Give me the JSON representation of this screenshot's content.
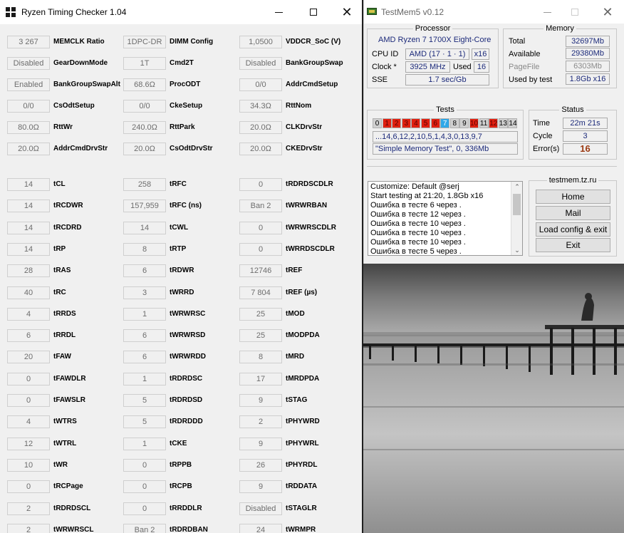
{
  "rtc": {
    "title": "Ryzen Timing Checker 1.04",
    "rows": [
      [
        {
          "v": "3 267",
          "l": "MEMCLK Ratio"
        },
        {
          "v": "1DPC-DR",
          "l": "DIMM Config"
        },
        {
          "v": "1,0500",
          "l": "VDDCR_SoC (V)"
        }
      ],
      [
        {
          "v": "Disabled",
          "l": "GearDownMode"
        },
        {
          "v": "1T",
          "l": "Cmd2T"
        },
        {
          "v": "Disabled",
          "l": "BankGroupSwap"
        }
      ],
      [
        {
          "v": "Enabled",
          "l": "BankGroupSwapAlt"
        },
        {
          "v": "68.6Ω",
          "l": "ProcODT"
        },
        {
          "v": "0/0",
          "l": "AddrCmdSetup"
        }
      ],
      [
        {
          "v": "0/0",
          "l": "CsOdtSetup"
        },
        {
          "v": "0/0",
          "l": "CkeSetup"
        },
        {
          "v": "34.3Ω",
          "l": "RttNom"
        }
      ],
      [
        {
          "v": "80.0Ω",
          "l": "RttWr"
        },
        {
          "v": "240.0Ω",
          "l": "RttPark"
        },
        {
          "v": "20.0Ω",
          "l": "CLKDrvStr"
        }
      ],
      [
        {
          "v": "20.0Ω",
          "l": "AddrCmdDrvStr"
        },
        {
          "v": "20.0Ω",
          "l": "CsOdtDrvStr"
        },
        {
          "v": "20.0Ω",
          "l": "CKEDrvStr"
        }
      ],
      [
        {
          "v": "14",
          "l": "tCL"
        },
        {
          "v": "258",
          "l": "tRFC"
        },
        {
          "v": "0",
          "l": "tRDRDSCDLR"
        }
      ],
      [
        {
          "v": "14",
          "l": "tRCDWR"
        },
        {
          "v": "157,959",
          "l": "tRFC (ns)"
        },
        {
          "v": "Ban 2",
          "l": "tWRWRBAN"
        }
      ],
      [
        {
          "v": "14",
          "l": "tRCDRD"
        },
        {
          "v": "14",
          "l": "tCWL"
        },
        {
          "v": "0",
          "l": "tWRWRSCDLR"
        }
      ],
      [
        {
          "v": "14",
          "l": "tRP"
        },
        {
          "v": "8",
          "l": "tRTP"
        },
        {
          "v": "0",
          "l": "tWRRDSCDLR"
        }
      ],
      [
        {
          "v": "28",
          "l": "tRAS"
        },
        {
          "v": "6",
          "l": "tRDWR"
        },
        {
          "v": "12746",
          "l": "tREF"
        }
      ],
      [
        {
          "v": "40",
          "l": "tRC"
        },
        {
          "v": "3",
          "l": "tWRRD"
        },
        {
          "v": "7 804",
          "l": "tREF (µs)"
        }
      ],
      [
        {
          "v": "4",
          "l": "tRRDS"
        },
        {
          "v": "1",
          "l": "tWRWRSC"
        },
        {
          "v": "25",
          "l": "tMOD"
        }
      ],
      [
        {
          "v": "6",
          "l": "tRRDL"
        },
        {
          "v": "6",
          "l": "tWRWRSD"
        },
        {
          "v": "25",
          "l": "tMODPDA"
        }
      ],
      [
        {
          "v": "20",
          "l": "tFAW"
        },
        {
          "v": "6",
          "l": "tWRWRDD"
        },
        {
          "v": "8",
          "l": "tMRD"
        }
      ],
      [
        {
          "v": "0",
          "l": "tFAWDLR"
        },
        {
          "v": "1",
          "l": "tRDRDSC"
        },
        {
          "v": "17",
          "l": "tMRDPDA"
        }
      ],
      [
        {
          "v": "0",
          "l": "tFAWSLR"
        },
        {
          "v": "5",
          "l": "tRDRDSD"
        },
        {
          "v": "9",
          "l": "tSTAG"
        }
      ],
      [
        {
          "v": "4",
          "l": "tWTRS"
        },
        {
          "v": "5",
          "l": "tRDRDDD"
        },
        {
          "v": "2",
          "l": "tPHYWRD"
        }
      ],
      [
        {
          "v": "12",
          "l": "tWTRL"
        },
        {
          "v": "1",
          "l": "tCKE"
        },
        {
          "v": "9",
          "l": "tPHYWRL"
        }
      ],
      [
        {
          "v": "10",
          "l": "tWR"
        },
        {
          "v": "0",
          "l": "tRPPB"
        },
        {
          "v": "26",
          "l": "tPHYRDL"
        }
      ],
      [
        {
          "v": "0",
          "l": "tRCPage"
        },
        {
          "v": "0",
          "l": "tRCPB"
        },
        {
          "v": "9",
          "l": "tRDDATA"
        }
      ],
      [
        {
          "v": "2",
          "l": "tRDRDSCL"
        },
        {
          "v": "0",
          "l": "tRRDDLR"
        },
        {
          "v": "Disabled",
          "l": "tSTAGLR"
        }
      ],
      [
        {
          "v": "2",
          "l": "tWRWRSCL"
        },
        {
          "v": "Ban 2",
          "l": "tRDRDBAN"
        },
        {
          "v": "24",
          "l": "tWRMPR"
        }
      ]
    ]
  },
  "tm": {
    "title": "TestMem5 v0.12",
    "processor": {
      "title": "Processor",
      "name": "AMD Ryzen 7 1700X Eight-Core",
      "cpu_id_label": "CPU ID",
      "cpu_id": "AMD  (17 · 1 · 1)",
      "threads": "x16",
      "clock_label": "Clock *",
      "clock": "3925 MHz",
      "used_label": "Used",
      "used": "16",
      "sse_label": "SSE",
      "sse": "1.7 sec/Gb"
    },
    "memory": {
      "title": "Memory",
      "total_label": "Total",
      "total": "32697Mb",
      "available_label": "Available",
      "available": "29380Mb",
      "pagefile_label": "PageFile",
      "pagefile": "6303Mb",
      "used_label": "Used by test",
      "used": "1.8Gb x16"
    },
    "tests": {
      "title": "Tests",
      "cells": [
        {
          "n": "0",
          "s": "ok"
        },
        {
          "n": "1",
          "s": "fail"
        },
        {
          "n": "2",
          "s": "fail"
        },
        {
          "n": "3",
          "s": "fail"
        },
        {
          "n": "4",
          "s": "fail"
        },
        {
          "n": "5",
          "s": "fail"
        },
        {
          "n": "6",
          "s": "fail"
        },
        {
          "n": "7",
          "s": "run"
        },
        {
          "n": "8",
          "s": "ok"
        },
        {
          "n": "9",
          "s": "ok"
        },
        {
          "n": "10",
          "s": "fail"
        },
        {
          "n": "11",
          "s": "ok"
        },
        {
          "n": "12",
          "s": "fail"
        },
        {
          "n": "13",
          "s": "ok"
        },
        {
          "n": "14",
          "s": "ok"
        }
      ],
      "sequence": "...14,6,12,2,10,5,1,4,3,0,13,9,7",
      "current": "\"Simple Memory Test\", 0, 336Mb"
    },
    "status": {
      "title": "Status",
      "time_label": "Time",
      "time": "22m 21s",
      "cycle_label": "Cycle",
      "cycle": "3",
      "errors_label": "Error(s)",
      "errors": "16"
    },
    "log": [
      "Customize: Default @serj",
      "Start testing at 21:20, 1.8Gb x16",
      "Ошибка в тесте 6 через .",
      "Ошибка в тесте 12 через .",
      "Ошибка в тесте 10 через .",
      "Ошибка в тесте 10 через .",
      "Ошибка в тесте 10 через .",
      "Ошибка в тесте 5 через ."
    ],
    "links": {
      "title": "testmem.tz.ru",
      "home": "Home",
      "mail": "Mail",
      "load": "Load config & exit",
      "exit": "Exit"
    }
  }
}
